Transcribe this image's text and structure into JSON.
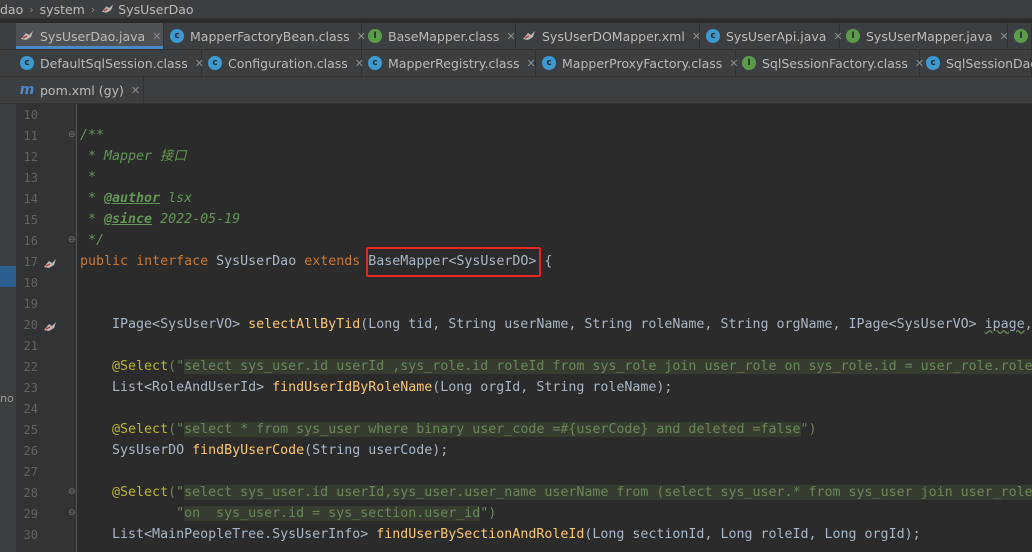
{
  "breadcrumb": {
    "items": [
      {
        "label": "dao"
      },
      {
        "label": "system"
      },
      {
        "label": "SysUserDao",
        "icon": "mybatis-bird-icon"
      }
    ]
  },
  "tabs_row1": [
    {
      "label": "SysUserDao.java",
      "icon": "mybatis-bird-icon",
      "active": true
    },
    {
      "label": "MapperFactoryBean.class",
      "icon": "class-icon"
    },
    {
      "label": "BaseMapper.class",
      "icon": "interface-icon"
    },
    {
      "label": "SysUserDOMapper.xml",
      "icon": "mybatis-bird-icon"
    },
    {
      "label": "SysUserApi.java",
      "icon": "class-icon"
    },
    {
      "label": "SysUserMapper.java",
      "icon": "interface-icon"
    }
  ],
  "tabs_row2": [
    {
      "label": "DefaultSqlSession.class",
      "icon": "class-icon"
    },
    {
      "label": "Configuration.class",
      "icon": "class-icon"
    },
    {
      "label": "MapperRegistry.class",
      "icon": "class-icon"
    },
    {
      "label": "MapperProxyFactory.class",
      "icon": "class-icon"
    },
    {
      "label": "SqlSessionFactory.class",
      "icon": "interface-icon"
    },
    {
      "label": "SqlSessionDao",
      "icon": "class-icon"
    }
  ],
  "tabs_row3": [
    {
      "label": "pom.xml (gy)",
      "icon": "maven-icon"
    }
  ],
  "tool_strip": {
    "label": "no"
  },
  "line_numbers": [
    "10",
    "11",
    "12",
    "13",
    "14",
    "15",
    "16",
    "17",
    "18",
    "19",
    "20",
    "21",
    "22",
    "23",
    "24",
    "25",
    "26",
    "27",
    "28",
    "29",
    "30"
  ],
  "colors": {
    "keyword": "#cc7832",
    "string": "#6a8759",
    "annotation": "#bbb529",
    "method": "#ffc66d",
    "field": "#9876aa",
    "highlight_box": "#e82323",
    "active_tab_underline": "#4a88c7"
  },
  "code": {
    "l11": "/**",
    "l12": " * Mapper 接口",
    "l13": " *",
    "l14_tag": "@author",
    "l14_val": " lsx",
    "l15_tag": "@since",
    "l15_val": " 2022-05-19",
    "l16": " */",
    "l17_public": "public",
    "l17_interface": "interface",
    "l17_name": "SysUserDao",
    "l17_extends": "extends",
    "l17_base": "BaseMapper<SysUserDO>",
    "l17_brace": " {",
    "l20_type": "IPage<SysUserVO> ",
    "l20_method": "selectAllByTid",
    "l20_params": "(Long tid, String userName, String roleName, String orgName, IPage<SysUserVO> ",
    "l20_ipage": "ipage",
    "l20_end": ",",
    "l22_annot": "@Select",
    "l22_open": "(\"",
    "l22_sql": "select sys_user.id userId ,sys_role.id roleId from sys_role join user_role on sys_role.id = user_role.role",
    "l23_type": "List<RoleAndUserId> ",
    "l23_method": "findUserIdByRoleName",
    "l23_params": "(Long orgId, String roleName);",
    "l25_annot": "@Select",
    "l25_open": "(\"",
    "l25_sql": "select * from sys_user where binary user_code =#{userCode} and deleted =false",
    "l25_close": "\")",
    "l26_type": "SysUserDO ",
    "l26_method": "findByUserCode",
    "l26_params": "(String userCode);",
    "l28_annot": "@Select",
    "l28_open": "(\"",
    "l28_sql": "select sys_user.id userId,sys_user.user_name userName from (select sys_user.* from sys_user join user_role",
    "l29_indent": "        \"",
    "l29_sql": "on  sys_user.id = sys_section.user_id",
    "l29_close": "\")",
    "l30_type": "List<MainPeopleTree.SysUserInfo> ",
    "l30_method": "findUserBySectionAndRoleId",
    "l30_params": "(Long sectionId, Long roleId, Long orgId);"
  }
}
